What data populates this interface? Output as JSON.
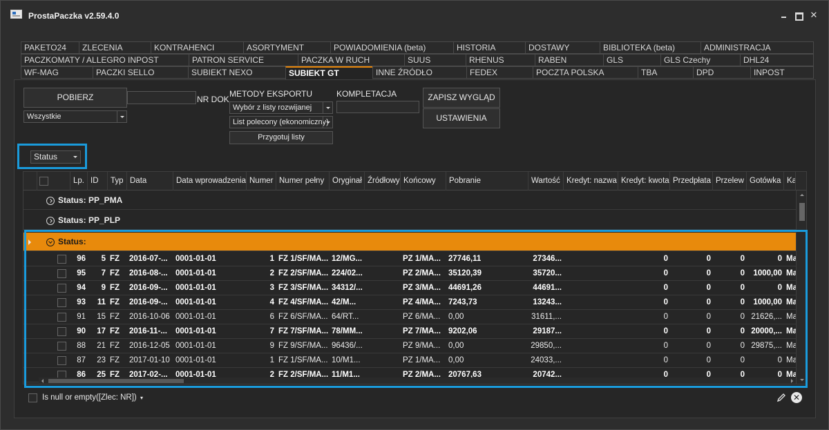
{
  "window": {
    "title": "ProstaPaczka v2.59.4.0",
    "close_glyph": "✕"
  },
  "tabs": {
    "row1": [
      "PAKETO24",
      "ZLECENIA",
      "KONTRAHENCI",
      "ASORTYMENT",
      "POWIADOMIENIA (beta)",
      "HISTORIA",
      "DOSTAWY",
      "BIBLIOTEKA (beta)",
      "ADMINISTRACJA"
    ],
    "row2": [
      "PACZKOMATY / ALLEGRO INPOST",
      "PATRON SERVICE",
      "PACZKA W RUCH",
      "SUUS",
      "RHENUS",
      "RABEN",
      "GLS",
      "GLS Czechy",
      "DHL24"
    ],
    "row3": [
      "WF-MAG",
      "PACZKI SELLO",
      "SUBIEKT NEXO",
      "SUBIEKT GT",
      "INNE ŹRÓDŁO",
      "FEDEX",
      "POCZTA POLSKA",
      "TBA",
      "DPD",
      "INPOST"
    ],
    "active": "SUBIEKT GT"
  },
  "toolbar": {
    "pobierz_label": "POBIERZ",
    "filter_select": "Wszystkie",
    "nr_dok_label": "NR DOK",
    "metody_eksportu_label": "METODY EKSPORTU",
    "metoda_select": "Wybór z listy rozwijanej",
    "list_select": "List polecony (ekonomiczny)",
    "przygotuj_label": "Przygotuj listy",
    "kompletacja_label": "KOMPLETACJA",
    "zapisz_label": "ZAPISZ WYGLĄD",
    "ustawienia_label": "USTAWIENIA"
  },
  "grouping": {
    "group_by": "Status"
  },
  "grid": {
    "columns": [
      "Lp.",
      "ID",
      "Typ",
      "Data",
      "Data wprowadzenia",
      "Numer",
      "Numer pełny",
      "Oryginał",
      "Źródłowy",
      "Końcowy",
      "Pobranie",
      "Wartość",
      "Kredyt: nazwa",
      "Kredyt: kwota",
      "Przedpłata",
      "Przelew",
      "Gotówka",
      "Ka"
    ],
    "groups": [
      {
        "label": "Status: PP_PMA",
        "expanded": false
      },
      {
        "label": "Status: PP_PLP",
        "expanded": false
      },
      {
        "label": "Status:",
        "expanded": true
      }
    ],
    "rows": [
      {
        "bold": true,
        "lp": "96",
        "id": "5",
        "typ": "FZ",
        "data": "2016-07-...",
        "data_wpr": "0001-01-01",
        "numer": "1",
        "numer_pelny": "FZ 1/SF/MA...",
        "oryginal": "12/MG...",
        "zrodlowy": "",
        "koncowy": "PZ 1/MA...",
        "pobranie": "27746,11",
        "wartosc": "27346...",
        "kredyt_nazwa": "",
        "kredyt_kwota": "0",
        "przedplata": "0",
        "przelew": "0",
        "gotowka": "0",
        "ka": "Ma"
      },
      {
        "bold": true,
        "lp": "95",
        "id": "7",
        "typ": "FZ",
        "data": "2016-08-...",
        "data_wpr": "0001-01-01",
        "numer": "2",
        "numer_pelny": "FZ 2/SF/MA...",
        "oryginal": "224/02...",
        "zrodlowy": "",
        "koncowy": "PZ 2/MA...",
        "pobranie": "35120,39",
        "wartosc": "35720...",
        "kredyt_nazwa": "",
        "kredyt_kwota": "0",
        "przedplata": "0",
        "przelew": "0",
        "gotowka": "1000,00",
        "ka": "Ma"
      },
      {
        "bold": true,
        "lp": "94",
        "id": "9",
        "typ": "FZ",
        "data": "2016-09-...",
        "data_wpr": "0001-01-01",
        "numer": "3",
        "numer_pelny": "FZ 3/SF/MA...",
        "oryginal": "34312/...",
        "zrodlowy": "",
        "koncowy": "PZ 3/MA...",
        "pobranie": "44691,26",
        "wartosc": "44691...",
        "kredyt_nazwa": "",
        "kredyt_kwota": "0",
        "przedplata": "0",
        "przelew": "0",
        "gotowka": "0",
        "ka": "Ma"
      },
      {
        "bold": true,
        "lp": "93",
        "id": "11",
        "typ": "FZ",
        "data": "2016-09-...",
        "data_wpr": "0001-01-01",
        "numer": "4",
        "numer_pelny": "FZ 4/SF/MA...",
        "oryginal": "42/M...",
        "zrodlowy": "",
        "koncowy": "PZ 4/MA...",
        "pobranie": "7243,73",
        "wartosc": "13243...",
        "kredyt_nazwa": "",
        "kredyt_kwota": "0",
        "przedplata": "0",
        "przelew": "0",
        "gotowka": "1000,00",
        "ka": "Ma"
      },
      {
        "bold": false,
        "lp": "91",
        "id": "15",
        "typ": "FZ",
        "data": "2016-10-06",
        "data_wpr": "0001-01-01",
        "numer": "6",
        "numer_pelny": "FZ 6/SF/MA...",
        "oryginal": "64/RT...",
        "zrodlowy": "",
        "koncowy": "PZ 6/MA...",
        "pobranie": "0,00",
        "wartosc": "31611,...",
        "kredyt_nazwa": "",
        "kredyt_kwota": "0",
        "przedplata": "0",
        "przelew": "0",
        "gotowka": "21626,...",
        "ka": "Ma"
      },
      {
        "bold": true,
        "lp": "90",
        "id": "17",
        "typ": "FZ",
        "data": "2016-11-...",
        "data_wpr": "0001-01-01",
        "numer": "7",
        "numer_pelny": "FZ 7/SF/MA...",
        "oryginal": "78/MM...",
        "zrodlowy": "",
        "koncowy": "PZ 7/MA...",
        "pobranie": "9202,06",
        "wartosc": "29187...",
        "kredyt_nazwa": "",
        "kredyt_kwota": "0",
        "przedplata": "0",
        "przelew": "0",
        "gotowka": "20000,...",
        "ka": "Ma"
      },
      {
        "bold": false,
        "lp": "88",
        "id": "21",
        "typ": "FZ",
        "data": "2016-12-05",
        "data_wpr": "0001-01-01",
        "numer": "9",
        "numer_pelny": "FZ 9/SF/MA...",
        "oryginal": "96436/...",
        "zrodlowy": "",
        "koncowy": "PZ 9/MA...",
        "pobranie": "0,00",
        "wartosc": "29850,...",
        "kredyt_nazwa": "",
        "kredyt_kwota": "0",
        "przedplata": "0",
        "przelew": "0",
        "gotowka": "29875,...",
        "ka": "Ma"
      },
      {
        "bold": false,
        "lp": "87",
        "id": "23",
        "typ": "FZ",
        "data": "2017-01-10",
        "data_wpr": "0001-01-01",
        "numer": "1",
        "numer_pelny": "FZ 1/SF/MA...",
        "oryginal": "10/M1...",
        "zrodlowy": "",
        "koncowy": "PZ 1/MA...",
        "pobranie": "0,00",
        "wartosc": "24033,...",
        "kredyt_nazwa": "",
        "kredyt_kwota": "0",
        "przedplata": "0",
        "przelew": "0",
        "gotowka": "0",
        "ka": "Ma"
      },
      {
        "bold": true,
        "lp": "86",
        "id": "25",
        "typ": "FZ",
        "data": "2017-02-...",
        "data_wpr": "0001-01-01",
        "numer": "2",
        "numer_pelny": "FZ 2/SF/MA...",
        "oryginal": "11/M1...",
        "zrodlowy": "",
        "koncowy": "PZ 2/MA...",
        "pobranie": "20767,63",
        "wartosc": "20742...",
        "kredyt_nazwa": "",
        "kredyt_kwota": "0",
        "przedplata": "0",
        "przelew": "0",
        "gotowka": "0",
        "ka": "Ma"
      }
    ]
  },
  "filter": {
    "text": "Is null or empty([Zlec: NR])",
    "edit_icon": "pencil-icon",
    "clear_glyph": "✕"
  },
  "colors": {
    "accent": "#e88a0c",
    "highlight": "#1a9bdc",
    "background": "#2d2d2d"
  }
}
